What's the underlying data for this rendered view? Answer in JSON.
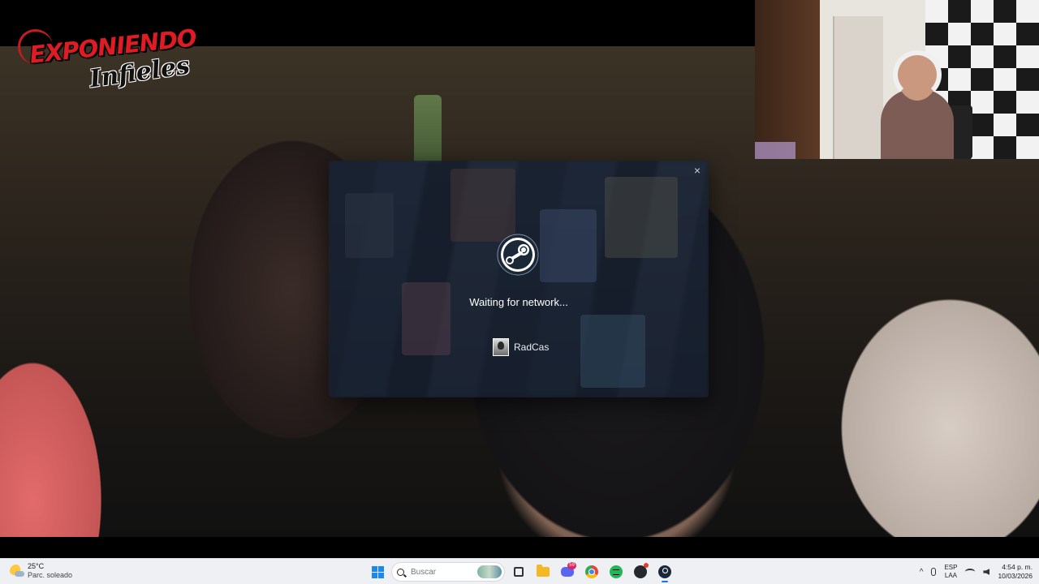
{
  "video": {
    "logo_line1": "EXPONIENDO",
    "logo_line2": "Infieles"
  },
  "steam_dialog": {
    "status": "Waiting for network...",
    "account_name": "RadCas",
    "close_symbol": "×",
    "logo_icon": "steam-logo-icon"
  },
  "taskbar": {
    "weather": {
      "temp": "25°C",
      "desc": "Parc. soleado"
    },
    "search": {
      "placeholder": "Buscar"
    },
    "discord_badge": "59",
    "tray": {
      "chevron": "^",
      "lang_top": "ESP",
      "lang_bottom": "LAA",
      "time": "4:54 p. m.",
      "date": "10/03/2026"
    }
  },
  "colors": {
    "steam_text": "#ffffff",
    "taskbar_bg": "#eef0f4",
    "windows_blue": "#1e88e5"
  }
}
